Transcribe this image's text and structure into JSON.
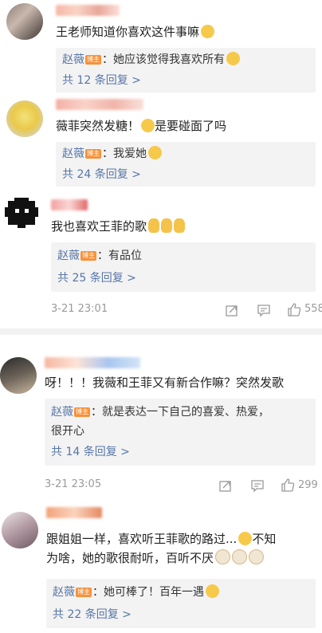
{
  "comments": [
    {
      "text": "王老师知道你喜欢这件事嘛",
      "reply": {
        "author": "赵薇",
        "badge": "博主",
        "text": "：她应该觉得我喜欢所有"
      },
      "reply_count": "共 12 条回复 >"
    },
    {
      "text": "薇菲突然发糖！",
      "text2": "是要碰面了吗",
      "reply": {
        "author": "赵薇",
        "badge": "博主",
        "text": "：我爱她"
      },
      "reply_count": "共 24 条回复 >"
    },
    {
      "text": "我也喜欢王菲的歌",
      "reply": {
        "author": "赵薇",
        "badge": "博主",
        "text": "：有品位"
      },
      "reply_count": "共 25 条回复 >",
      "time": "3-21 23:01",
      "like_count": "558"
    },
    {
      "text": "呀！！！我薇和王菲又有新合作嘛？突然发歌",
      "reply": {
        "author": "赵薇",
        "badge": "博主",
        "text": "：就是表达一下自己的喜爱、热爱，",
        "text2": "很开心"
      },
      "reply_count": "共 14 条回复 >",
      "time": "3-21 23:05",
      "like_count": "299"
    },
    {
      "text": "跟姐姐一样，喜欢听王菲歌的路过...",
      "text_b": "不知",
      "text2": "为啥，她的歌很耐听，百听不厌",
      "reply": {
        "author": "赵薇",
        "badge": "博主",
        "text": "：她可棒了！百年一遇"
      },
      "reply_count": "共 22 条回复 >"
    }
  ],
  "icons": {
    "repost": "repost-icon",
    "comment": "comment-icon",
    "like": "thumbs-up-icon"
  },
  "colors": {
    "link": "#5876a8",
    "badge": "#f7923a",
    "reply_bg": "#f3f3f3",
    "meta": "#9a9a9a"
  }
}
